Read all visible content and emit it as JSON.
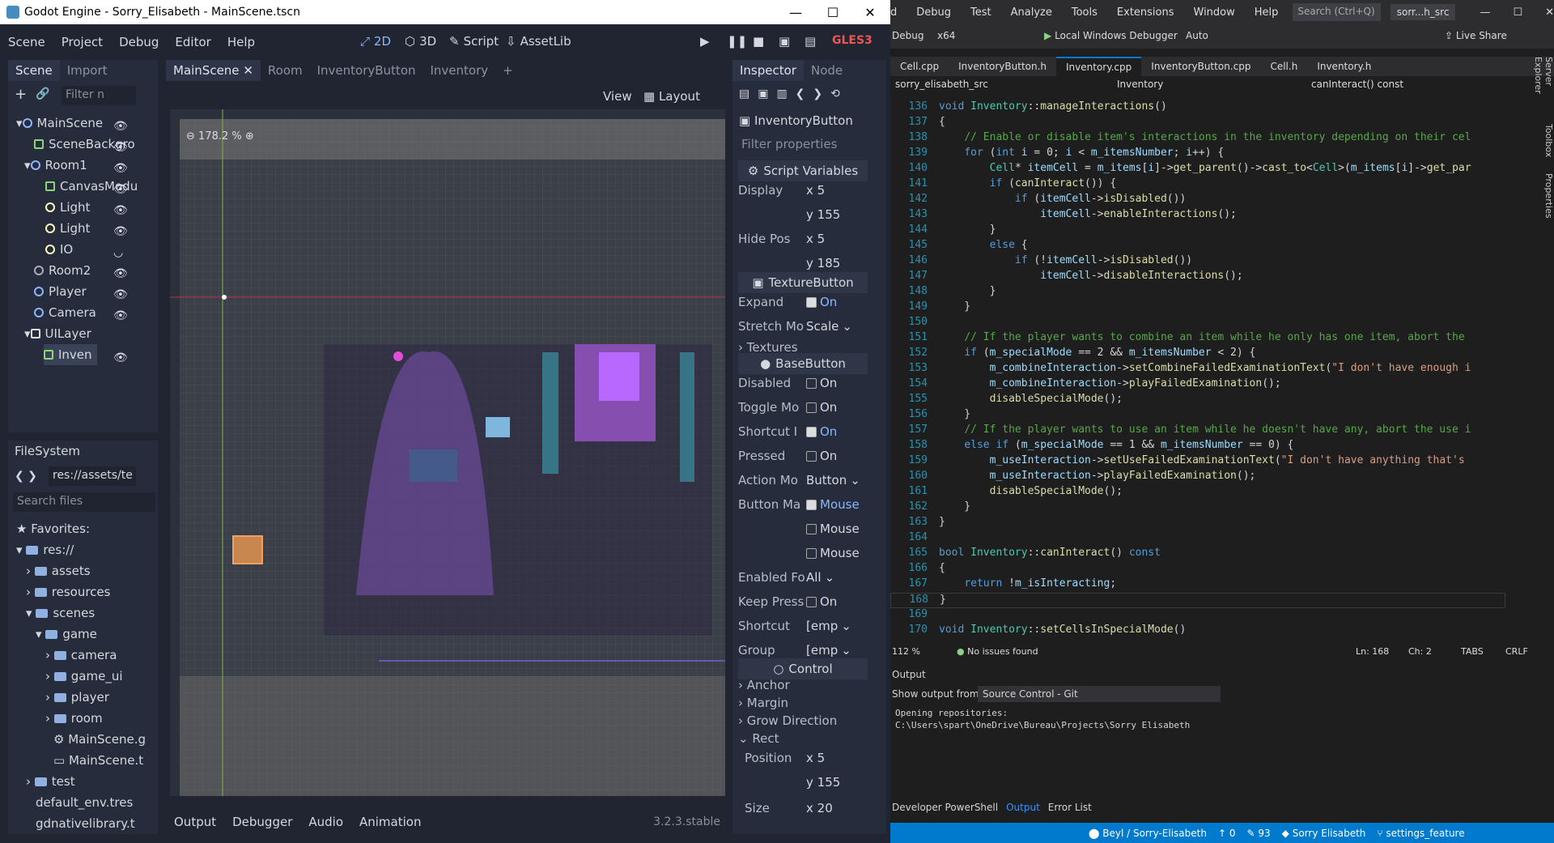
{
  "godot": {
    "title": "Godot Engine - Sorry_Elisabeth - MainScene.tscn",
    "menu": [
      "Scene",
      "Project",
      "Debug",
      "Editor",
      "Help"
    ],
    "workspaces": [
      "2D",
      "3D",
      "Script",
      "AssetLib"
    ],
    "renderer": "GLES3",
    "scene_tabs": [
      "Scene",
      "Import"
    ],
    "scene_filter_placeholder": "Filter n",
    "tree": [
      "MainScene",
      "SceneBackgro",
      "Room1",
      "CanvasModu",
      "Light",
      "Light",
      "IO",
      "Room2",
      "Player",
      "Camera",
      "UILayer",
      "Inven"
    ],
    "fs_title": "FileSystem",
    "fs_path": "res://assets/te",
    "fs_search": "Search files",
    "fs_items": [
      "Favorites:",
      "res://",
      "assets",
      "resources",
      "scenes",
      "game",
      "camera",
      "game_ui",
      "player",
      "room",
      "MainScene.g",
      "MainScene.t",
      "test",
      "default_env.tres",
      "gdnativelibrary.t"
    ],
    "editor_tabs": [
      "MainScene",
      "Room",
      "InventoryButton",
      "Inventory"
    ],
    "view_toolbar": [
      "View",
      "Layout"
    ],
    "zoom": "178.2 %",
    "bottom_tabs": [
      "Output",
      "Debugger",
      "Audio",
      "Animation"
    ],
    "version": "3.2.3.stable",
    "inspector_tabs": [
      "Inspector",
      "Node"
    ],
    "inspector_node": "InventoryButton",
    "inspector_filter": "Filter properties",
    "sections": {
      "script": "Script Variables",
      "texture": "TextureButton",
      "base": "BaseButton",
      "control": "Control"
    },
    "props": [
      {
        "l": "Display",
        "v": "x 5"
      },
      {
        "l": "",
        "v": "y 155"
      },
      {
        "l": "Hide Pos",
        "v": "x 5"
      },
      {
        "l": "",
        "v": "y 185"
      }
    ],
    "props2": [
      {
        "l": "Expand",
        "v": "On"
      },
      {
        "l": "Stretch Mo",
        "v": "Scale"
      }
    ],
    "textures": "Textures",
    "props3": [
      {
        "l": "Disabled",
        "v": "On"
      },
      {
        "l": "Toggle Mo",
        "v": "On"
      },
      {
        "l": "Shortcut I",
        "v": "On"
      },
      {
        "l": "Pressed",
        "v": "On"
      },
      {
        "l": "Action Mo",
        "v": "Button"
      },
      {
        "l": "Button Ma",
        "v": "Mouse"
      },
      {
        "l": "",
        "v": "Mouse"
      },
      {
        "l": "",
        "v": "Mouse"
      },
      {
        "l": "Enabled Fo",
        "v": "All"
      },
      {
        "l": "Keep Press",
        "v": "On"
      },
      {
        "l": "Shortcut",
        "v": "[emp"
      },
      {
        "l": "Group",
        "v": "[emp"
      }
    ],
    "control_items": [
      "Anchor",
      "Margin",
      "Grow Direction",
      "Rect"
    ],
    "rect": [
      {
        "l": "Position",
        "v": "x 5"
      },
      {
        "l": "",
        "v": "y 155"
      },
      {
        "l": "Size",
        "v": "x 20"
      }
    ]
  },
  "vs": {
    "menu": [
      "d",
      "Debug",
      "Test",
      "Analyze",
      "Tools",
      "Extensions",
      "Window",
      "Help"
    ],
    "search": "Search (Ctrl+Q)",
    "sol": "sorr...h_src",
    "config": "Debug",
    "platform": "x64",
    "debugger": "Local Windows Debugger",
    "auto": "Auto",
    "liveshare": "Live Share",
    "tabs": [
      "Cell.cpp",
      "InventoryButton.h",
      "Inventory.cpp",
      "InventoryButton.cpp",
      "Cell.h",
      "Inventory.h"
    ],
    "nav": [
      "sorry_elisabeth_src",
      "Inventory",
      "canInteract() const"
    ],
    "zoom": "112 %",
    "issues": "No issues found",
    "ln": "Ln: 168",
    "ch": "Ch: 2",
    "tabs_mode": "TABS",
    "eol": "CRLF",
    "output_title": "Output",
    "show_from": "Show output from:",
    "source": "Source Control - Git",
    "out_lines": [
      "Opening repositories:",
      "C:\\Users\\spart\\OneDrive\\Bureau\\Projects\\Sorry Elisabeth"
    ],
    "bottom_tabs": [
      "Developer PowerShell",
      "Output",
      "Error List"
    ],
    "status": [
      "Beyl / Sorry-Elisabeth",
      "0",
      "93",
      "Sorry Elisabeth",
      "settings_feature"
    ],
    "side": [
      "Server Explorer",
      "Toolbox",
      "Properties"
    ]
  }
}
